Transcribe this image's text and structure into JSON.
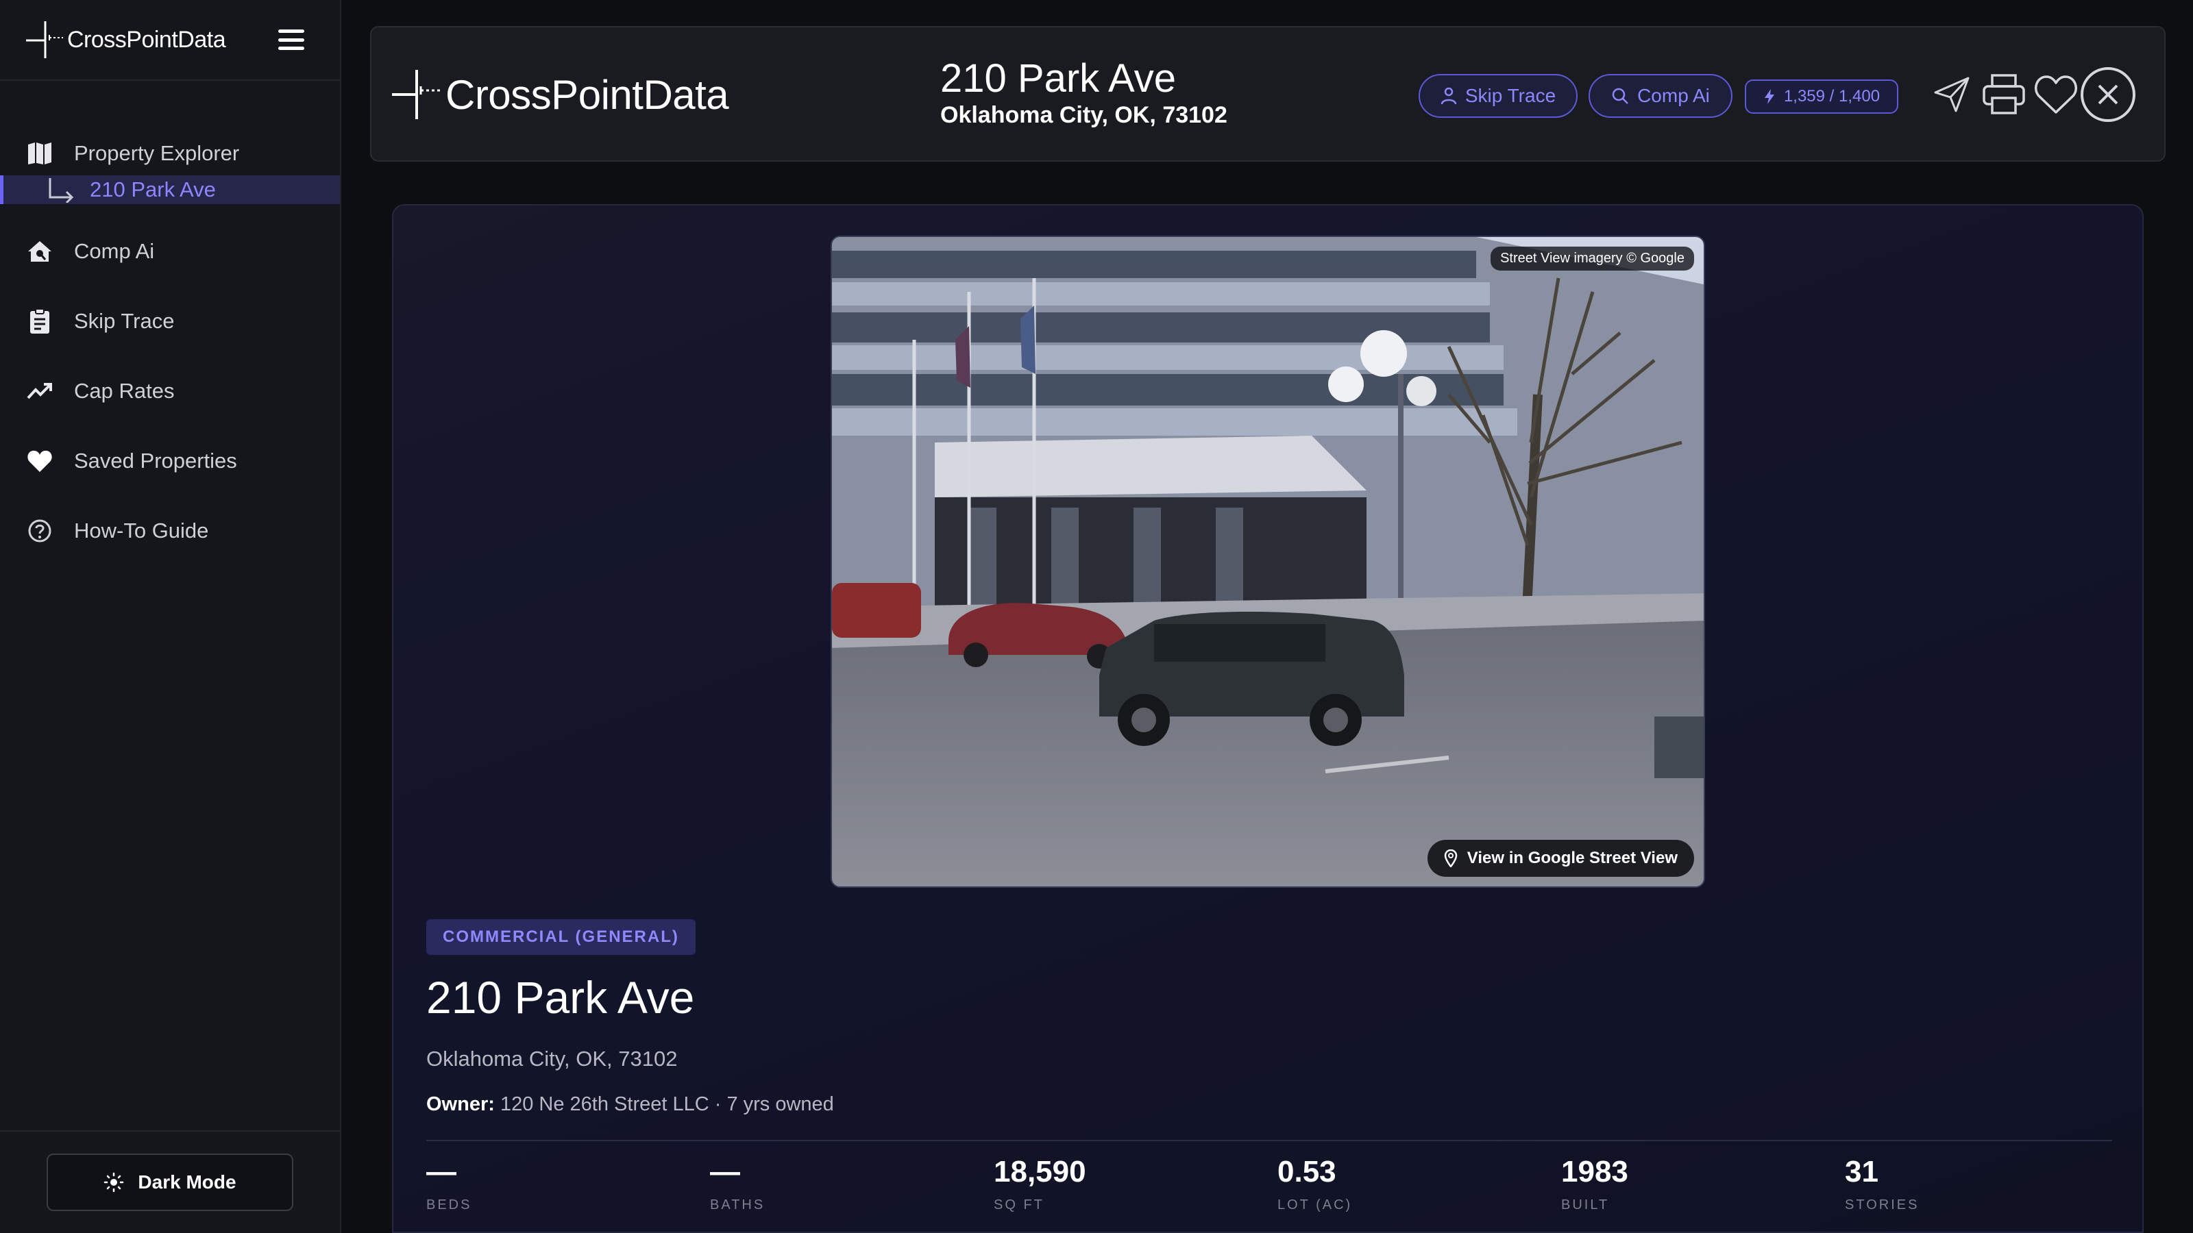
{
  "app": {
    "brand": "CrossPointData"
  },
  "sidebar": {
    "items": [
      {
        "label": "Property Explorer",
        "icon": "map-icon"
      },
      {
        "label": "Comp Ai",
        "icon": "home-search-icon"
      },
      {
        "label": "Skip Trace",
        "icon": "clipboard-icon"
      },
      {
        "label": "Cap Rates",
        "icon": "trend-up-icon"
      },
      {
        "label": "Saved Properties",
        "icon": "heart-icon"
      },
      {
        "label": "How-To Guide",
        "icon": "help-circle-icon"
      }
    ],
    "sub_item": "210 Park Ave",
    "dark_mode_label": "Dark Mode"
  },
  "header": {
    "title": "210 Park Ave",
    "subtitle": "Oklahoma City, OK, 73102",
    "skip_trace_label": "Skip Trace",
    "comp_ai_label": "Comp Ai",
    "credits": "1,359 / 1,400"
  },
  "property": {
    "photo_credit": "Street View imagery © Google",
    "street_view_label": "View in Google Street View",
    "type_tag": "COMMERCIAL (GENERAL)",
    "address": "210 Park Ave",
    "city_line": "Oklahoma City, OK, 73102",
    "owner_label": "Owner:",
    "owner_value": "120 Ne 26th Street LLC · 7 yrs owned",
    "stats": [
      {
        "value": "—",
        "label": "BEDS"
      },
      {
        "value": "—",
        "label": "BATHS"
      },
      {
        "value": "18,590",
        "label": "SQ FT"
      },
      {
        "value": "0.53",
        "label": "LOT (AC)"
      },
      {
        "value": "1983",
        "label": "BUILT"
      },
      {
        "value": "31",
        "label": "STORIES"
      }
    ]
  },
  "colors": {
    "accent": "#6c63ff",
    "accent_text": "#8d86ff",
    "background": "#0d0e12"
  }
}
